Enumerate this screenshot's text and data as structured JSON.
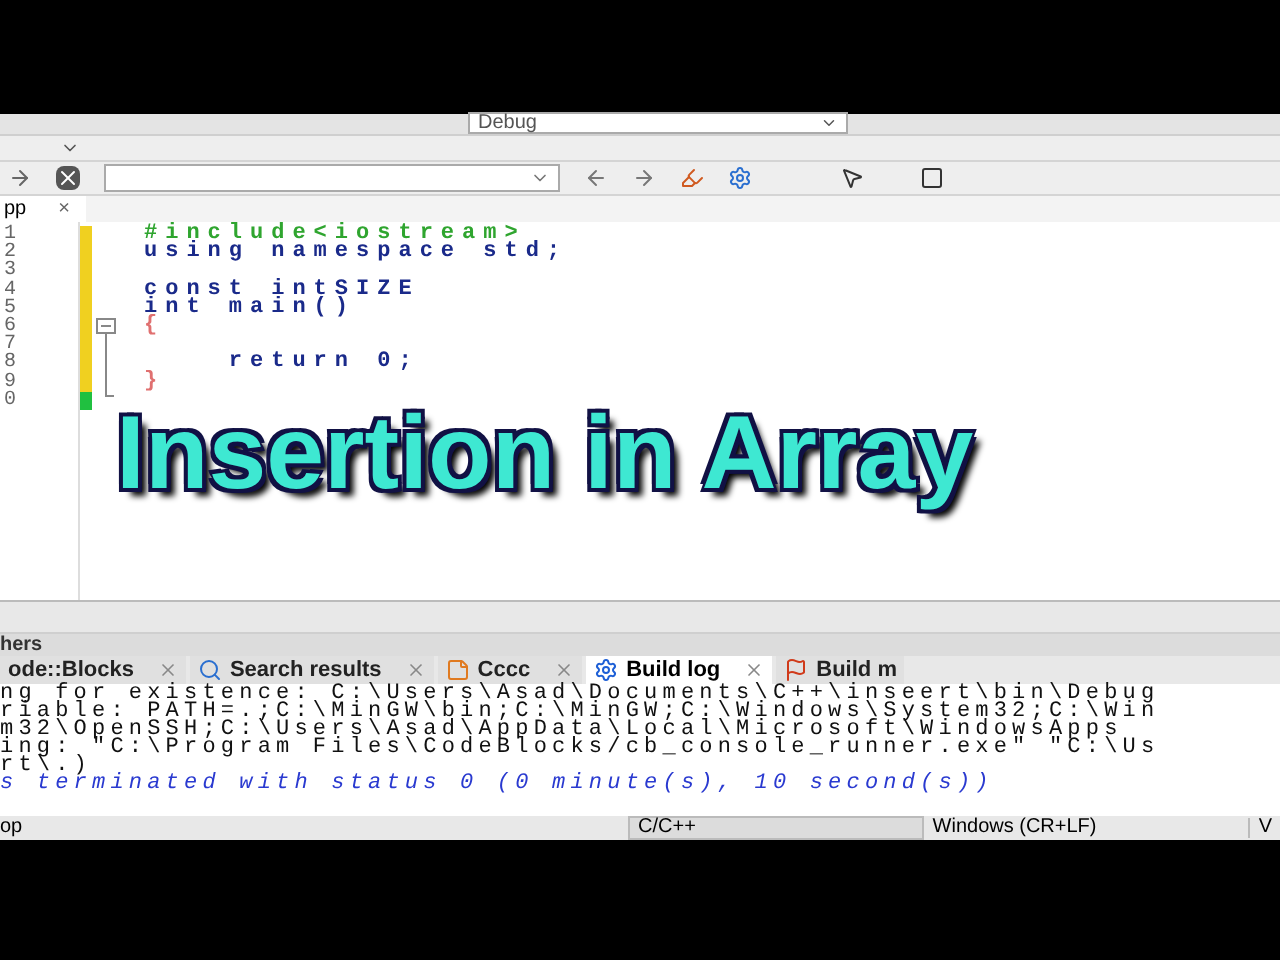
{
  "toolbar": {
    "build_target": "Debug"
  },
  "editor": {
    "tab": {
      "label": "pp",
      "close": "×"
    },
    "lines": [
      {
        "number": "1",
        "text": "#include<iostream>",
        "kind": "preprocessor"
      },
      {
        "number": "2",
        "text": "using namespace std;",
        "kind": "code"
      },
      {
        "number": "3"
      },
      {
        "number": "4",
        "text": "const intSIZE",
        "kind": "code"
      },
      {
        "number": "5",
        "text": "int main()",
        "kind": "code"
      },
      {
        "number": "6",
        "text": "{",
        "kind": "brace"
      },
      {
        "number": "7"
      },
      {
        "number": "8",
        "text": "    return 0;",
        "kind": "code"
      },
      {
        "number": "9",
        "text": "}",
        "kind": "brace"
      },
      {
        "number": "0"
      }
    ]
  },
  "overlay_title": "Insertion in Array",
  "logs_panel": {
    "title": "hers",
    "tabs": [
      {
        "label": "ode::Blocks",
        "selected": false
      },
      {
        "label": "Search results",
        "selected": false
      },
      {
        "label": "Cccc",
        "selected": false
      },
      {
        "label": "Build log",
        "selected": true
      },
      {
        "label": "Build m",
        "selected": false
      }
    ],
    "log": [
      {
        "text": "ng for existence: C:\\Users\\Asad\\Documents\\C++\\inseert\\bin\\Debug",
        "kind": "normal"
      },
      {
        "text": "riable: PATH=.;C:\\MinGW\\bin;C:\\MinGW;C:\\Windows\\System32;C:\\Win",
        "kind": "normal"
      },
      {
        "text": "m32\\OpenSSH;C:\\Users\\Asad\\AppData\\Local\\Microsoft\\WindowsApps",
        "kind": "normal"
      },
      {
        "text": "ing: \"C:\\Program Files\\CodeBlocks/cb_console_runner.exe\" \"C:\\Us",
        "kind": "normal"
      },
      {
        "text": "rt\\.)",
        "kind": "normal"
      },
      {
        "text": "s terminated with status 0 (0 minute(s), 10 second(s))",
        "kind": "status"
      }
    ]
  },
  "status_bar": [
    "op",
    "C/C++",
    "Windows (CR+LF)",
    "V"
  ]
}
